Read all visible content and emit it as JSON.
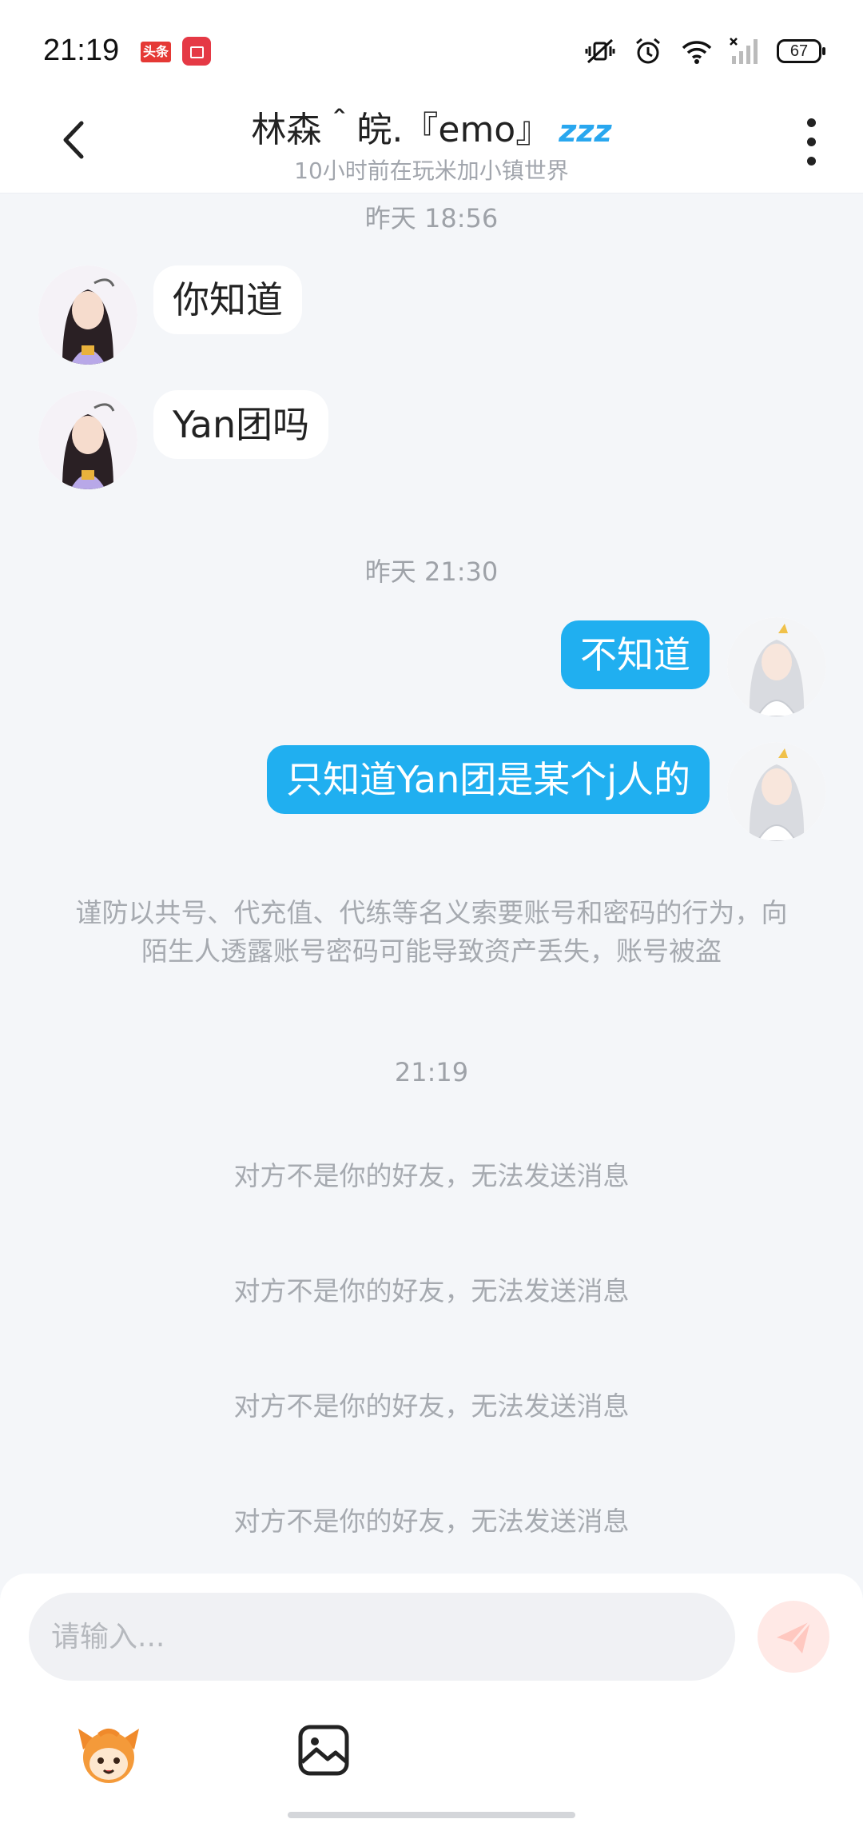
{
  "status_bar": {
    "time": "21:19",
    "app_badge_1": "头条",
    "battery_level": "67",
    "icons": [
      "mute-vibrate-icon",
      "alarm-icon",
      "wifi-icon",
      "signal-icon",
      "battery-icon"
    ]
  },
  "header": {
    "title": "林森＾皖.『emo』",
    "status_emoji": "zzz",
    "subtitle": "10小时前在玩米加小镇世界"
  },
  "messages": [
    {
      "type": "timestamp",
      "text": "昨天 18:56"
    },
    {
      "type": "incoming",
      "text": "你知道"
    },
    {
      "type": "incoming",
      "text": "Yan团吗"
    },
    {
      "type": "timestamp",
      "text": "昨天 21:30"
    },
    {
      "type": "outgoing",
      "text": "不知道"
    },
    {
      "type": "outgoing",
      "text": "只知道Yan团是某个j人的"
    },
    {
      "type": "warning",
      "text": "谨防以共号、代充值、代练等名义索要账号和密码的行为，向陌生人透露账号密码可能导致资产丢失，账号被盗"
    },
    {
      "type": "timestamp",
      "text": "21:19"
    },
    {
      "type": "system",
      "text": "对方不是你的好友，无法发送消息"
    },
    {
      "type": "system",
      "text": "对方不是你的好友，无法发送消息"
    },
    {
      "type": "system",
      "text": "对方不是你的好友，无法发送消息"
    },
    {
      "type": "system",
      "text": "对方不是你的好友，无法发送消息"
    }
  ],
  "composer": {
    "placeholder": "请输入...",
    "value": ""
  },
  "colors": {
    "accent_blue": "#20aff0",
    "send_disabled": "#ffe9e6",
    "background": "#f4f6f9"
  }
}
